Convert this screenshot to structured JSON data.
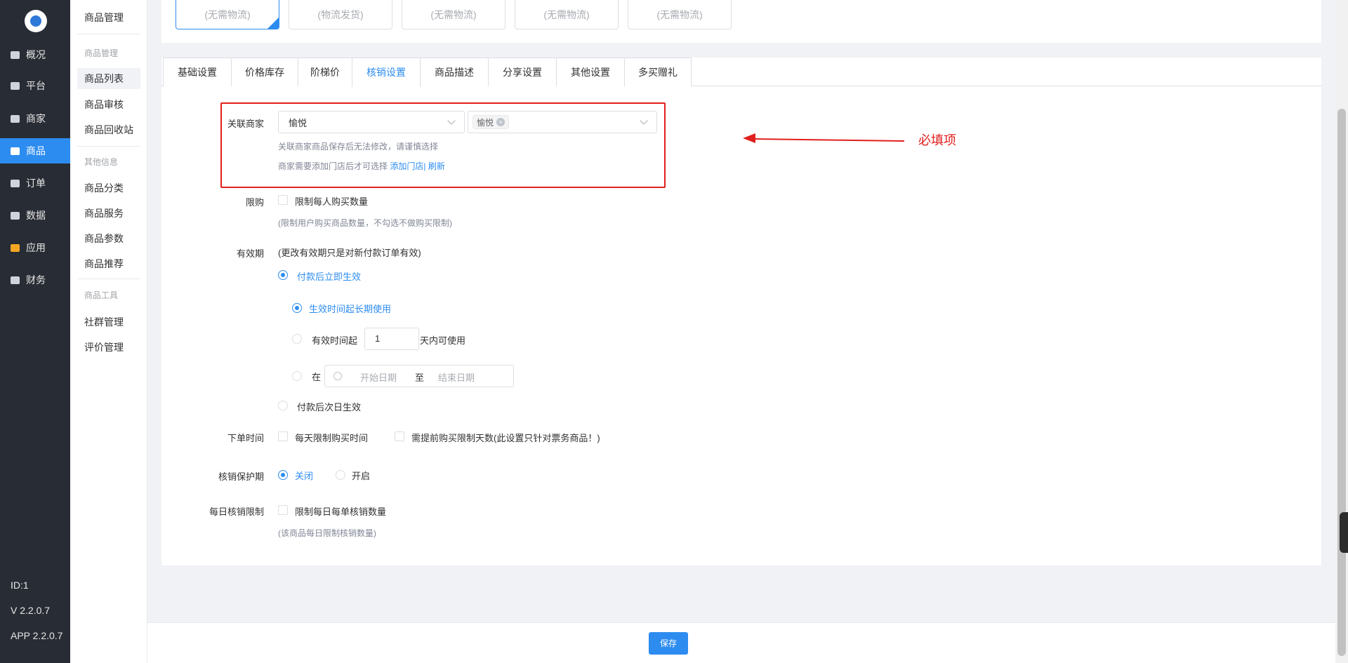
{
  "nav": {
    "items": [
      {
        "label": "概况",
        "icon": "monitor-icon"
      },
      {
        "label": "平台",
        "icon": "desktop-icon"
      },
      {
        "label": "商家",
        "icon": "store-icon"
      },
      {
        "label": "商品",
        "icon": "goods-icon",
        "active": true
      },
      {
        "label": "订单",
        "icon": "order-icon"
      },
      {
        "label": "数据",
        "icon": "bar-chart-icon"
      },
      {
        "label": "应用",
        "icon": "apps-icon"
      },
      {
        "label": "财务",
        "icon": "finance-icon"
      }
    ],
    "footer": {
      "id": "ID:1",
      "version": "V 2.2.0.7",
      "app_version": "APP 2.2.0.7"
    }
  },
  "submenu": {
    "title": "商品管理",
    "groups": [
      {
        "label": "商品管理",
        "items": [
          "商品列表",
          "商品审核",
          "商品回收站"
        ]
      },
      {
        "label": "其他信息",
        "items": [
          "商品分类",
          "商品服务",
          "商品参数",
          "商品推荐"
        ]
      },
      {
        "label": "商品工具",
        "items": [
          "社群管理",
          "评价管理"
        ]
      }
    ],
    "active_item": "商品列表"
  },
  "shipping_options": [
    "(无需物流)",
    "(物流发货)",
    "(无需物流)",
    "(无需物流)",
    "(无需物流)"
  ],
  "tabs": [
    "基础设置",
    "价格库存",
    "阶梯价",
    "核销设置",
    "商品描述",
    "分享设置",
    "其他设置",
    "多买赠礼"
  ],
  "active_tab": "核销设置",
  "form": {
    "merchant": {
      "label": "关联商家",
      "value": "愉悦",
      "store_tag": "愉悦",
      "hint1": "关联商家商品保存后无法修改，请谨慎选择",
      "hint2_prefix": "商家需要添加门店后才可选择",
      "hint2_link1": "添加门店|",
      "hint2_link2": "刷新"
    },
    "purchase_limit": {
      "label": "限购",
      "option": "限制每人购买数量",
      "hint": "(限制用户购买商品数量，不勾选不做购买限制)"
    },
    "validity": {
      "label": "有效期",
      "note": "(更改有效期只是对新付款订单有效)",
      "opt_immediate": "付款后立即生效",
      "sub_long_term": "生效时间起长期使用",
      "sub_days_prefix": "有效时间起",
      "sub_days_value": "1",
      "sub_days_suffix": "天内可使用",
      "sub_range_prefix": "在",
      "start_placeholder": "开始日期",
      "range_sep": "至",
      "end_placeholder": "结束日期",
      "opt_next_day": "付款后次日生效"
    },
    "order_time": {
      "label": "下单时间",
      "opt1": "每天限制购买时间",
      "opt2": "需提前购买限制天数(此设置只针对票务商品！)"
    },
    "protect": {
      "label": "核销保护期",
      "off": "关闭",
      "on": "开启"
    },
    "daily_limit": {
      "label": "每日核销限制",
      "option": "限制每日每单核销数量",
      "hint": "(该商品每日限制核销数量)"
    }
  },
  "annotation": {
    "text": "必填项",
    "color": "#e0201c"
  },
  "save_button": "保存",
  "colors": {
    "primary": "#2d8cf0",
    "nav_bg": "#282c34",
    "annotation_red": "#e0201c"
  }
}
